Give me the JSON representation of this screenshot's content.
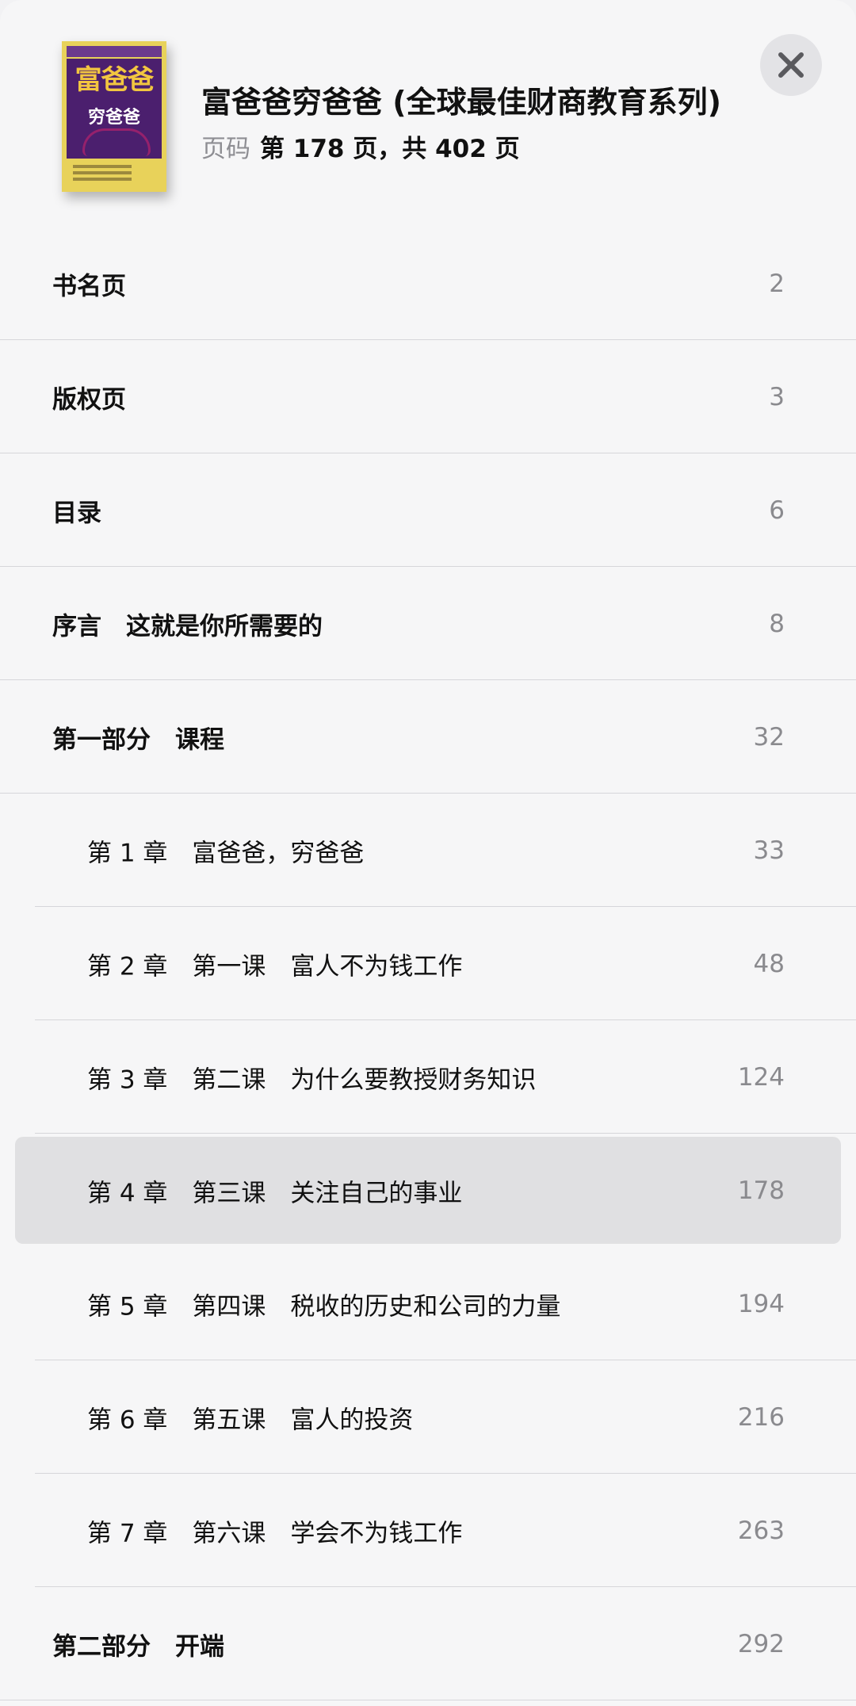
{
  "header": {
    "cover": {
      "title": "富爸爸",
      "subtitle": "穷爸爸",
      "colors": {
        "background": "#4b1f6e",
        "border": "#e8d25a",
        "title": "#f2c640"
      }
    },
    "book_title": "富爸爸穷爸爸 (全球最佳财商教育系列)",
    "page_label": "页码",
    "page_value": "第 178 页，共 402 页",
    "close_icon": "close-icon"
  },
  "toc": {
    "items": [
      {
        "label": "书名页",
        "page": "2",
        "level": 0,
        "current": false
      },
      {
        "label": "版权页",
        "page": "3",
        "level": 0,
        "current": false
      },
      {
        "label": "目录",
        "page": "6",
        "level": 0,
        "current": false
      },
      {
        "label": "序言　这就是你所需要的",
        "page": "8",
        "level": 0,
        "current": false
      },
      {
        "label": "第一部分　课程",
        "page": "32",
        "level": 0,
        "current": false
      },
      {
        "label": "第 1 章　富爸爸，穷爸爸",
        "page": "33",
        "level": 1,
        "current": false
      },
      {
        "label": "第 2 章　第一课　富人不为钱工作",
        "page": "48",
        "level": 1,
        "current": false
      },
      {
        "label": "第 3 章　第二课　为什么要教授财务知识",
        "page": "124",
        "level": 1,
        "current": false
      },
      {
        "label": "第 4 章　第三课　关注自己的事业",
        "page": "178",
        "level": 1,
        "current": true
      },
      {
        "label": "第 5 章　第四课　税收的历史和公司的力量",
        "page": "194",
        "level": 1,
        "current": false
      },
      {
        "label": "第 6 章　第五课　富人的投资",
        "page": "216",
        "level": 1,
        "current": false
      },
      {
        "label": "第 7 章　第六课　学会不为钱工作",
        "page": "263",
        "level": 1,
        "current": false
      },
      {
        "label": "第二部分　开端",
        "page": "292",
        "level": 0,
        "current": false
      }
    ]
  },
  "colors": {
    "background": "#f6f6f7",
    "highlight": "#e0e0e2",
    "separator": "#d6d6da",
    "page_number": "#8a8a8e"
  }
}
